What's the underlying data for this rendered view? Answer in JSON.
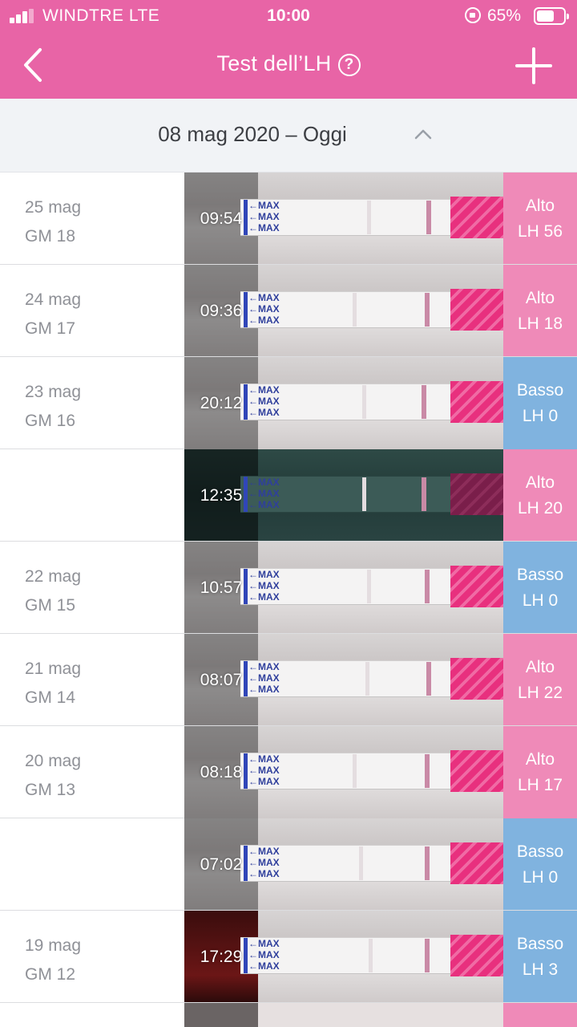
{
  "status_bar": {
    "carrier": "WINDTRE  LTE",
    "time": "10:00",
    "battery_percent": "65%",
    "battery_level": 0.65,
    "signal_bars": 3
  },
  "nav": {
    "title": "Test dell’LH",
    "help_icon": "?",
    "back_icon": "chevron-left-icon",
    "add_icon": "plus-icon"
  },
  "month_header": {
    "label": "08 mag 2020 – Oggi",
    "toggle_icon": "chevron-up-icon"
  },
  "colors": {
    "brand": "#e864a6",
    "alto": "#ef8ab8",
    "basso": "#80b3df",
    "date_text": "#8f9197"
  },
  "entries": [
    {
      "date": "25 mag",
      "cycle_day": "GM 18",
      "time": "09:54",
      "level": "Alto",
      "lh": "LH 56",
      "type": "alto"
    },
    {
      "date": "24 mag",
      "cycle_day": "GM 17",
      "time": "09:36",
      "level": "Alto",
      "lh": "LH 18",
      "type": "alto"
    },
    {
      "date": "23 mag",
      "cycle_day": "GM 16",
      "time": "20:12",
      "level": "Basso",
      "lh": "LH 0",
      "type": "basso"
    },
    {
      "date": "",
      "cycle_day": "",
      "time": "12:35",
      "level": "Alto",
      "lh": "LH 20",
      "type": "alto"
    },
    {
      "date": "22 mag",
      "cycle_day": "GM 15",
      "time": "10:57",
      "level": "Basso",
      "lh": "LH 0",
      "type": "basso"
    },
    {
      "date": "21 mag",
      "cycle_day": "GM 14",
      "time": "08:07",
      "level": "Alto",
      "lh": "LH 22",
      "type": "alto"
    },
    {
      "date": "20 mag",
      "cycle_day": "GM 13",
      "time": "08:18",
      "level": "Alto",
      "lh": "LH 17",
      "type": "alto"
    },
    {
      "date": "",
      "cycle_day": "",
      "time": "07:02",
      "level": "Basso",
      "lh": "LH 0",
      "type": "basso"
    },
    {
      "date": "19 mag",
      "cycle_day": "GM 12",
      "time": "17:29",
      "level": "Basso",
      "lh": "LH 3",
      "type": "basso"
    }
  ],
  "strip_label": "←MAX"
}
